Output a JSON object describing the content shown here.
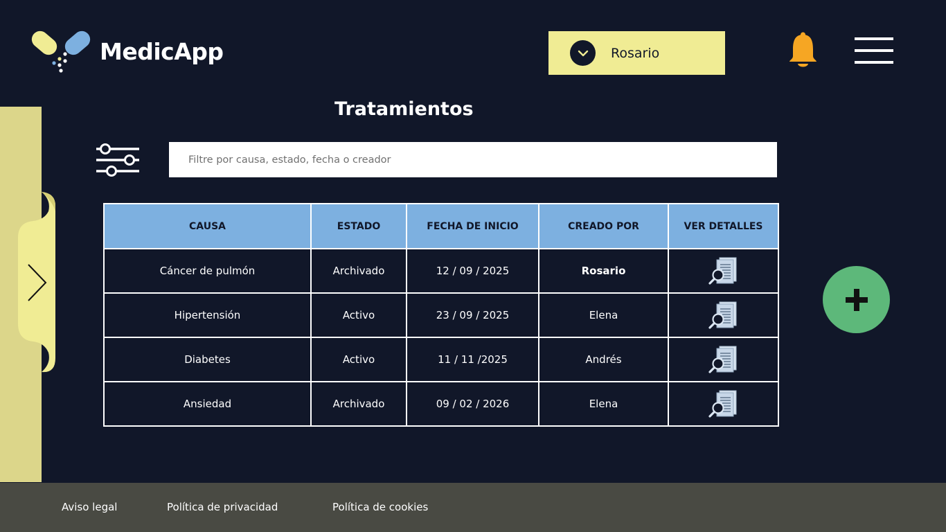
{
  "app": {
    "name": "MedicApp"
  },
  "user_select": {
    "selected": "Rosario"
  },
  "page": {
    "title": "Tratamientos"
  },
  "search": {
    "placeholder": "Filtre por causa, estado, fecha o creador",
    "value": ""
  },
  "table": {
    "columns": [
      "CAUSA",
      "ESTADO",
      "FECHA DE INICIO",
      "CREADO POR",
      "VER DETALLES"
    ],
    "rows": [
      {
        "causa": "Cáncer de pulmón",
        "estado": "Archivado",
        "fecha": "12 / 09 / 2025",
        "creado_por": "Rosario",
        "highlight_creator": true
      },
      {
        "causa": "Hipertensión",
        "estado": "Activo",
        "fecha": "23 / 09 / 2025",
        "creado_por": "Elena"
      },
      {
        "causa": "Diabetes",
        "estado": "Activo",
        "fecha": "11 / 11 /2025",
        "creado_por": "Andrés"
      },
      {
        "causa": "Ansiedad",
        "estado": "Archivado",
        "fecha": "09 / 02 / 2026",
        "creado_por": "Elena"
      }
    ]
  },
  "footer": {
    "links": [
      "Aviso legal",
      "Política de privacidad",
      "Política de cookies"
    ]
  },
  "icons": {
    "logo": "pill-heart-logo",
    "user_dropdown": "chevron-down-icon",
    "notifications": "bell-icon",
    "menu": "hamburger-menu-icon",
    "side_toggle": "chevron-right-icon",
    "filters": "sliders-icon",
    "details": "document-search-icon",
    "add": "plus-icon"
  },
  "colors": {
    "background": "#111729",
    "accent_yellow": "#f0ec94",
    "side_panel": "#dcd68a",
    "table_header": "#7db0e0",
    "add_button": "#5db87a",
    "bell": "#f6a623",
    "footer": "#494a43"
  }
}
